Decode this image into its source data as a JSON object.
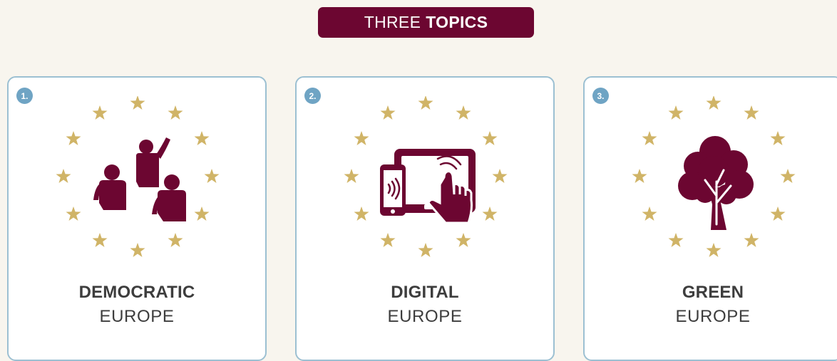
{
  "header": {
    "light": "THREE",
    "bold": "TOPICS"
  },
  "colors": {
    "accent": "#6c0631",
    "star": "#d0b467",
    "badge": "#6fa4c4",
    "border": "#9cc0d2",
    "background": "#f8f5ee"
  },
  "topics": [
    {
      "number": "1.",
      "title": "DEMOCRATIC",
      "subtitle": "EUROPE",
      "icon": "people-icon"
    },
    {
      "number": "2.",
      "title": "DIGITAL",
      "subtitle": "EUROPE",
      "icon": "devices-icon"
    },
    {
      "number": "3.",
      "title": "GREEN",
      "subtitle": "EUROPE",
      "icon": "tree-icon"
    }
  ]
}
